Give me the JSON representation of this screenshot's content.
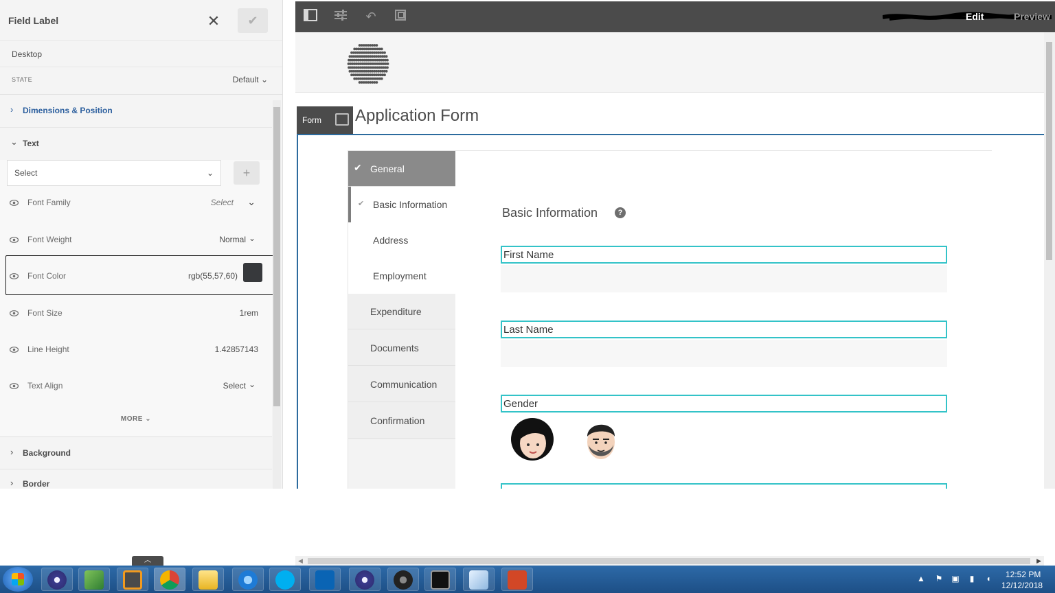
{
  "style_panel": {
    "title": "Field Label",
    "breakpoint": "Desktop",
    "state_label": "STATE",
    "state_value": "Default",
    "sections": {
      "dimensions": "Dimensions & Position",
      "text": "Text",
      "background": "Background",
      "border": "Border"
    },
    "text_select_placeholder": "Select",
    "properties": [
      {
        "name": "Font Family",
        "value": "Select"
      },
      {
        "name": "Font Weight",
        "value": "Normal"
      },
      {
        "name": "Font Color",
        "value": "rgb(55,57,60)"
      },
      {
        "name": "Font Size",
        "value": "1rem"
      },
      {
        "name": "Line Height",
        "value": "1.42857143"
      },
      {
        "name": "Text Align",
        "value": "Select"
      }
    ],
    "more_label": "MORE",
    "font_color_swatch": "#37393c"
  },
  "editor_toolbar": {
    "edit_label": "Edit",
    "preview_label": "Preview"
  },
  "form": {
    "badge_label": "Form",
    "title": "Application Form",
    "nav": [
      {
        "label": "General",
        "state": "active"
      },
      {
        "label": "Basic Information",
        "state": "current-sub"
      },
      {
        "label": "Address",
        "state": "sub"
      },
      {
        "label": "Employment",
        "state": "sub"
      },
      {
        "label": "Expenditure",
        "state": "top"
      },
      {
        "label": "Documents",
        "state": "top"
      },
      {
        "label": "Communication",
        "state": "top"
      },
      {
        "label": "Confirmation",
        "state": "top"
      }
    ],
    "panel_title": "Basic Information",
    "fields": {
      "first_name": "First Name",
      "last_name": "Last Name",
      "gender": "Gender"
    },
    "accent_color": "#33c3c8"
  },
  "taskbar": {
    "time": "12:52 PM",
    "date": "12/12/2018"
  }
}
